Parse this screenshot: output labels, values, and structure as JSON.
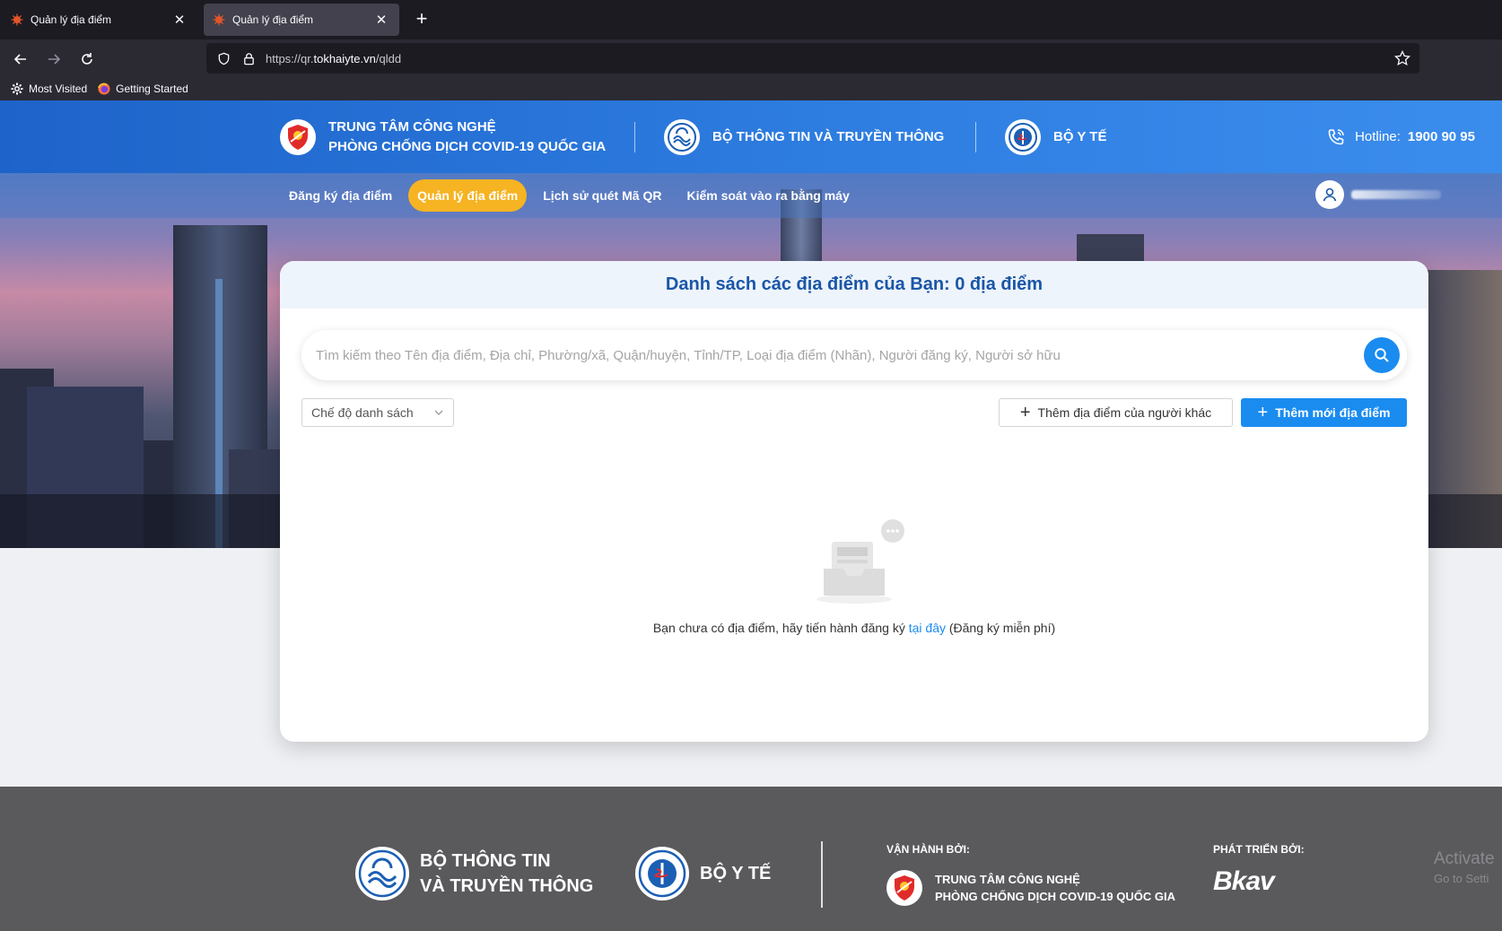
{
  "browser": {
    "tabs": [
      {
        "title": "Quản lý địa điểm"
      },
      {
        "title": "Quản lý địa điểm"
      }
    ],
    "url_prefix": "https://qr.",
    "url_domain": "tokhaiyte.vn",
    "url_path": "/qldd",
    "bookmarks": [
      {
        "label": "Most Visited"
      },
      {
        "label": "Getting Started"
      }
    ]
  },
  "header": {
    "brand1_line1": "TRUNG TÂM CÔNG NGHỆ",
    "brand1_line2": "PHÒNG CHỐNG DỊCH COVID-19 QUỐC GIA",
    "brand2": "BỘ THÔNG TIN VÀ TRUYỀN THÔNG",
    "brand3": "BỘ Y TẾ",
    "hotline_label": "Hotline:",
    "hotline_number": "1900 90 95"
  },
  "menu": {
    "items": [
      {
        "label": "Đăng ký địa điểm"
      },
      {
        "label": "Quản lý địa điểm"
      },
      {
        "label": "Lịch sử quét Mã QR"
      },
      {
        "label": "Kiểm soát vào ra bằng máy"
      }
    ]
  },
  "card": {
    "title": "Danh sách các địa điểm của Bạn: 0 địa điểm",
    "search_placeholder": "Tìm kiếm theo Tên địa điểm, Địa chỉ, Phường/xã, Quận/huyện, Tỉnh/TP, Loại địa điểm (Nhãn), Người đăng ký, Người sở hữu",
    "mode_select": "Chế độ danh sách",
    "btn_other": "Thêm địa điểm của người khác",
    "btn_new": "Thêm mới địa điểm",
    "empty_before": "Bạn chưa có địa điểm, hãy tiến hành đăng ký ",
    "empty_link": "tại đây",
    "empty_after": " (Đăng ký miễn phí)"
  },
  "footer": {
    "brand1_line1": "BỘ THÔNG TIN",
    "brand1_line2": "VÀ TRUYỀN THÔNG",
    "brand2": "BỘ Y TẾ",
    "operated_label": "VẬN HÀNH BỞI:",
    "operator_line1": "TRUNG TÂM CÔNG NGHỆ",
    "operator_line2": "PHÒNG CHỐNG DỊCH COVID-19 QUỐC GIA",
    "developed_label": "PHÁT TRIỂN BỞI:",
    "developer": "Bkav",
    "activate_line1": "Activate",
    "activate_line2": "Go to Setti"
  },
  "colors": {
    "header_blue": "#1e63c9",
    "accent_yellow": "#f6b322",
    "primary_button": "#1a8cf0",
    "title_blue": "#1a56a8",
    "footer_gray": "#5a5a5d"
  },
  "icons": [
    "virus-favicon",
    "close-icon",
    "plus-icon",
    "back-icon",
    "forward-icon",
    "reload-icon",
    "shield-icon",
    "lock-icon",
    "star-icon",
    "gear-icon",
    "firefox-icon",
    "phone-icon",
    "user-icon",
    "search-icon",
    "chevron-down-icon",
    "empty-inbox-icon"
  ]
}
